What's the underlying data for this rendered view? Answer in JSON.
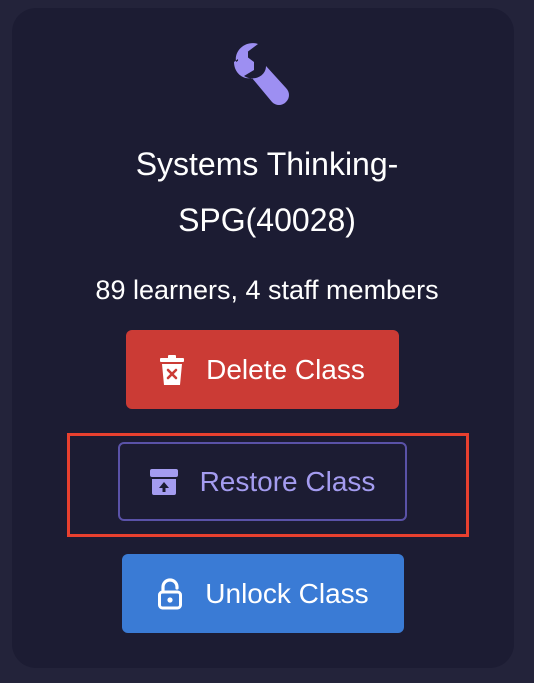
{
  "card": {
    "icon": "wrench-icon",
    "title_line1": "Systems Thinking-",
    "title_line2": "SPG(40028)",
    "meta": "89 learners, 4 staff members"
  },
  "actions": {
    "delete": {
      "label": "Delete Class",
      "icon": "trash-icon",
      "color": "#cb3b35"
    },
    "restore": {
      "label": "Restore Class",
      "icon": "archive-restore-icon",
      "color": "#a49cf0"
    },
    "unlock": {
      "label": "Unlock Class",
      "icon": "unlock-icon",
      "color": "#3a7bd5"
    }
  },
  "highlight_color": "#e8402f",
  "accent": "#9d8ff2"
}
